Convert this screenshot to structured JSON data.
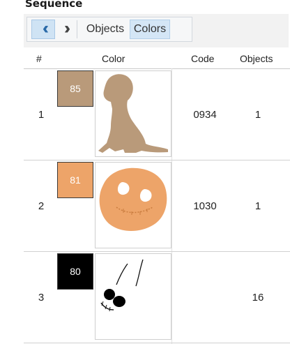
{
  "panel": {
    "title": "Sequence"
  },
  "toolbar": {
    "prev_icon": "double-chevron-left-icon",
    "next_icon": "double-chevron-right-icon",
    "tabs": [
      {
        "label": "Objects",
        "active": false
      },
      {
        "label": "Colors",
        "active": true
      }
    ]
  },
  "table": {
    "columns": [
      "#",
      "Color",
      "Code",
      "Objects"
    ],
    "rows": [
      {
        "num": "1",
        "swatch_label": "85",
        "swatch_color": "#b99a7a",
        "code": "0934",
        "objects": "1",
        "thumb": "dog-silhouette"
      },
      {
        "num": "2",
        "swatch_label": "81",
        "swatch_color": "#eda469",
        "code": "1030",
        "objects": "1",
        "thumb": "pumpkin-face"
      },
      {
        "num": "3",
        "swatch_label": "80",
        "swatch_color": "#000000",
        "code": "",
        "objects": "16",
        "thumb": "black-face-details"
      }
    ]
  },
  "colors": {
    "selected_tab_bg": "#d4e6f6",
    "nav_active_bg": "#cfe3f4"
  }
}
